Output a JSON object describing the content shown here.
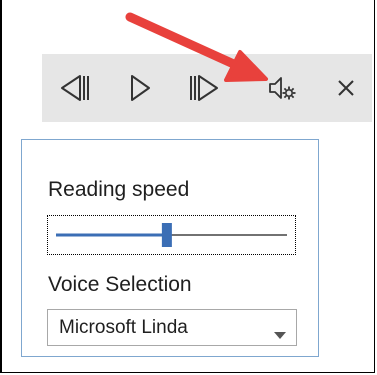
{
  "toolbar": {
    "buttons": [
      {
        "icon": "previous-paragraph-icon"
      },
      {
        "icon": "play-icon"
      },
      {
        "icon": "next-paragraph-icon"
      },
      {
        "icon": "voice-settings-icon"
      },
      {
        "icon": "close-icon"
      }
    ]
  },
  "settings_panel": {
    "reading_speed_label": "Reading speed",
    "reading_speed_value": 0.48,
    "voice_selection_label": "Voice Selection",
    "voice_selected": "Microsoft Linda"
  },
  "colors": {
    "toolbar_bg": "#e6e6e6",
    "annotation_arrow": "#e8413c",
    "slider_accent": "#3b6eb5",
    "popup_border": "#7fa7cf"
  }
}
